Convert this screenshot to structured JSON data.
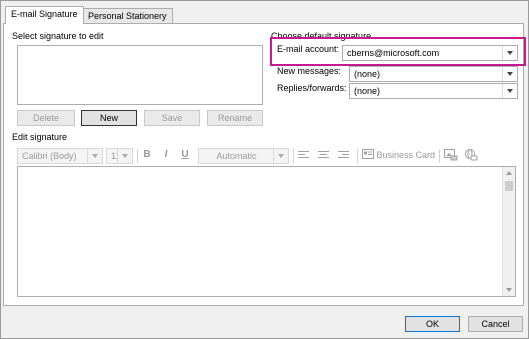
{
  "tabs": {
    "email_signature": "E-mail Signature",
    "personal_stationery": "Personal Stationery"
  },
  "select_section": {
    "label": "Select signature to edit",
    "buttons": {
      "delete": "Delete",
      "new": "New",
      "save": "Save",
      "rename": "Rename"
    }
  },
  "default_section": {
    "label": "Choose default signature",
    "email_account_label": "E-mail account:",
    "email_account_value": "cberns@microsoft.com",
    "new_messages_label": "New messages:",
    "new_messages_value": "(none)",
    "replies_label": "Replies/forwards:",
    "replies_value": "(none)"
  },
  "edit_section": {
    "label": "Edit signature",
    "font_value": "Calibri (Body)",
    "size_value": "11",
    "bold": "B",
    "italic": "I",
    "underline": "U",
    "color_value": "Automatic",
    "business_card": "Business Card"
  },
  "footer": {
    "ok": "OK",
    "cancel": "Cancel"
  },
  "colors": {
    "highlight": "#c8188f",
    "primary_button_border": "#0078d7"
  }
}
